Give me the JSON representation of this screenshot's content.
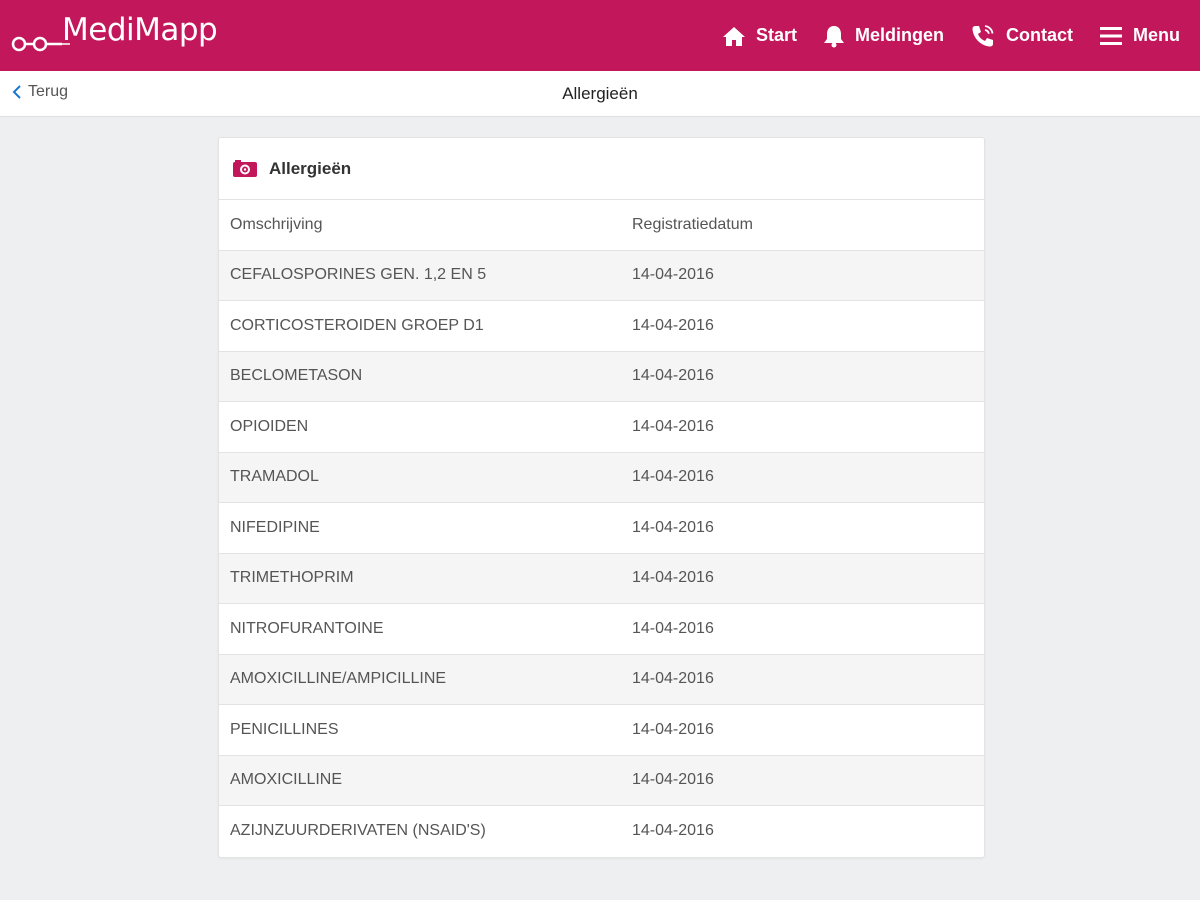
{
  "app": {
    "logo_text": "MediMapp",
    "accent_color": "#c2185b"
  },
  "nav": {
    "items": [
      {
        "label": "Start",
        "icon": "home-icon"
      },
      {
        "label": "Meldingen",
        "icon": "bell-icon"
      },
      {
        "label": "Contact",
        "icon": "phone-icon"
      },
      {
        "label": "Menu",
        "icon": "hamburger-icon"
      }
    ]
  },
  "subheader": {
    "back_label": "Terug",
    "title": "Allergieën"
  },
  "card": {
    "title": "Allergieën",
    "icon": "allergy-icon",
    "columns": [
      "Omschrijving",
      "Registratiedatum"
    ],
    "rows": [
      {
        "description": "CEFALOSPORINES GEN. 1,2 EN 5",
        "date": "14-04-2016"
      },
      {
        "description": "CORTICOSTEROIDEN GROEP D1",
        "date": "14-04-2016"
      },
      {
        "description": "BECLOMETASON",
        "date": "14-04-2016"
      },
      {
        "description": "OPIOIDEN",
        "date": "14-04-2016"
      },
      {
        "description": "TRAMADOL",
        "date": "14-04-2016"
      },
      {
        "description": "NIFEDIPINE",
        "date": "14-04-2016"
      },
      {
        "description": "TRIMETHOPRIM",
        "date": "14-04-2016"
      },
      {
        "description": "NITROFURANTOINE",
        "date": "14-04-2016"
      },
      {
        "description": "AMOXICILLINE/AMPICILLINE",
        "date": "14-04-2016"
      },
      {
        "description": "PENICILLINES",
        "date": "14-04-2016"
      },
      {
        "description": "AMOXICILLINE",
        "date": "14-04-2016"
      },
      {
        "description": "AZIJNZUURDERIVATEN (NSAID'S)",
        "date": "14-04-2016"
      }
    ]
  }
}
